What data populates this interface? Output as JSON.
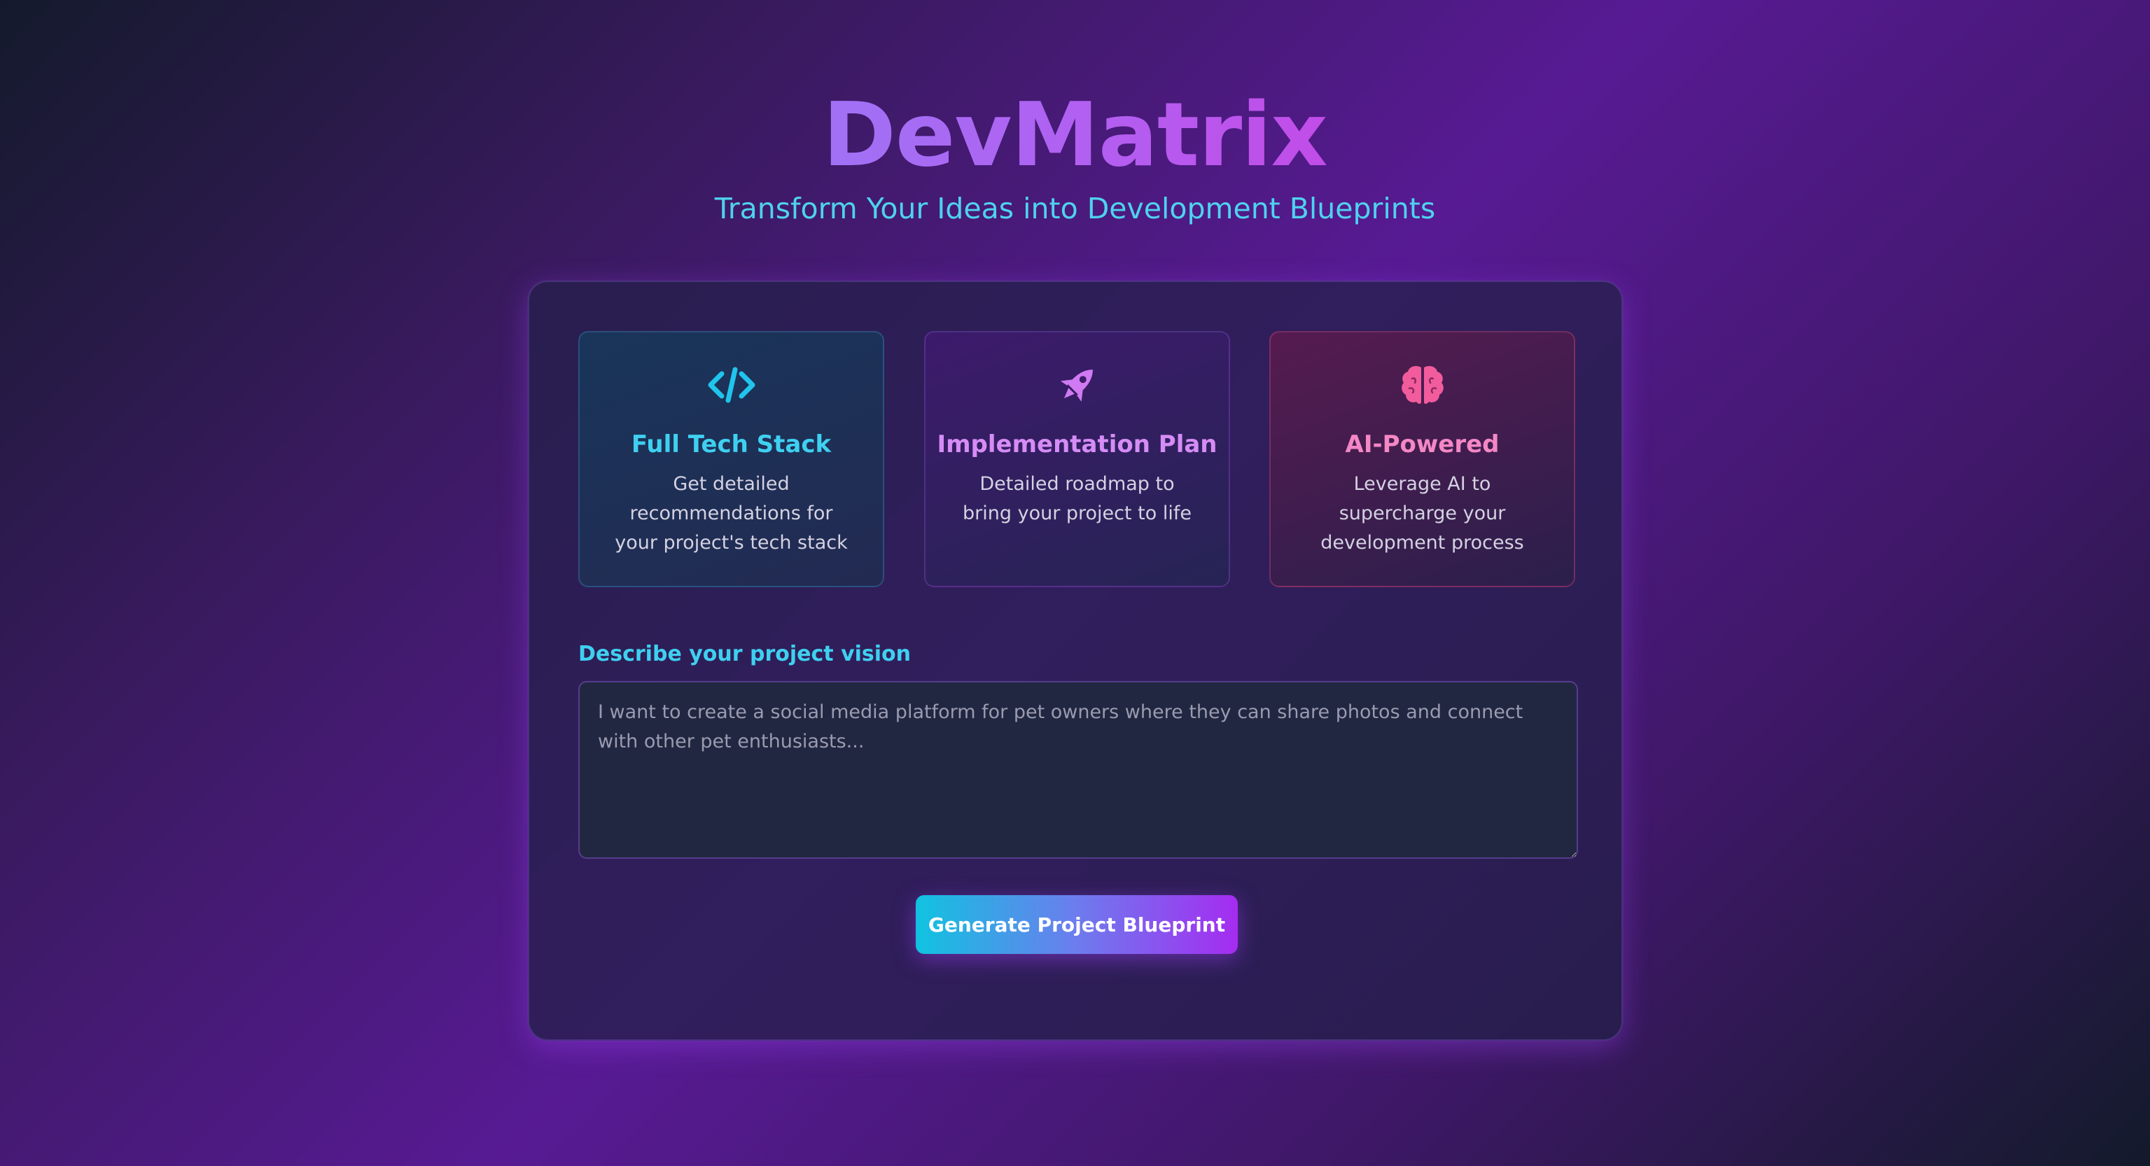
{
  "header": {
    "title": "DevMatrix",
    "subtitle": "Transform Your Ideas into Development Blueprints"
  },
  "features": [
    {
      "icon": "code-icon",
      "title": "Full Tech Stack",
      "description": "Get detailed recommendations for your project's tech stack",
      "color": "#3fd0f0"
    },
    {
      "icon": "rocket-icon",
      "title": "Implementation Plan",
      "description": "Detailed roadmap to bring your project to life",
      "color": "#d58cf5"
    },
    {
      "icon": "brain-icon",
      "title": "AI-Powered",
      "description": "Leverage AI to supercharge your development process",
      "color": "#f487c5"
    }
  ],
  "form": {
    "label": "Describe your project vision",
    "placeholder": "I want to create a social media platform for pet owners where they can share photos and connect with other pet enthusiasts...",
    "value": "",
    "submit_label": "Generate Project Blueprint"
  },
  "colors": {
    "accent_cyan": "#3fd0f0",
    "accent_purple": "#a52cf0",
    "accent_pink": "#f487c5"
  }
}
